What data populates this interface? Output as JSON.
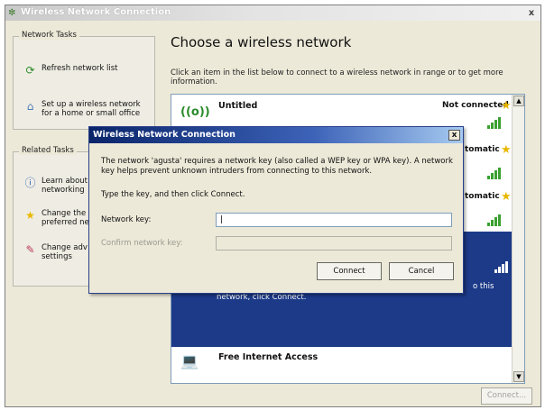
{
  "window": {
    "title": "Wireless Network Connection",
    "close_glyph": "x"
  },
  "network_tasks": {
    "title": "Network Tasks",
    "items": [
      {
        "icon": "refresh-icon",
        "label": "Refresh network list"
      },
      {
        "icon": "setup-wireless-icon",
        "label": "Set up a wireless network for a home or small office"
      }
    ]
  },
  "related_tasks": {
    "title": "Related Tasks",
    "items": [
      {
        "icon": "info-icon",
        "label": "Learn about networking"
      },
      {
        "icon": "star-icon",
        "label": "Change the preferred ne"
      },
      {
        "icon": "settings-icon",
        "label": "Change adv settings"
      }
    ]
  },
  "main": {
    "heading": "Choose a wireless network",
    "description": "Click an item in the list below to connect to a wireless network in range or to get more information."
  },
  "networks": [
    {
      "name": "Untitled",
      "status": "Not connected",
      "icon": "wireless-antenna-icon"
    },
    {
      "name": "",
      "status": "tomatic"
    },
    {
      "name": "",
      "status": "tomatic"
    },
    {
      "name": "",
      "status": "",
      "selected": true,
      "selected_text": "network, click Connect.",
      "selected_text_right": "o this"
    },
    {
      "name": "Free Internet Access",
      "status": "",
      "icon": "laptop-wireless-icon"
    }
  ],
  "connect_button": "Connect...",
  "dialog": {
    "title": "Wireless Network Connection",
    "close_glyph": "x",
    "message": "The network 'agusta' requires a network key (also called a WEP key or WPA key). A network key helps prevent unknown intruders from connecting to this network.",
    "instruction": "Type the key, and then click Connect.",
    "network_key_label": "Network key:",
    "network_key_value": "|",
    "confirm_key_label": "Confirm network key:",
    "connect_label": "Connect",
    "cancel_label": "Cancel"
  },
  "colors": {
    "selection": "#1c3a88",
    "dialog_title": "#0a246a",
    "signal": "#3aa030",
    "star": "#e8b800"
  }
}
